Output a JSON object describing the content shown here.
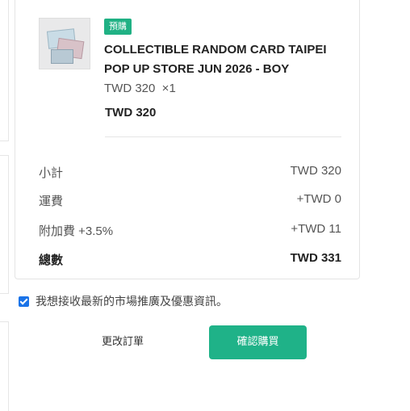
{
  "product": {
    "badge": "預購",
    "name": "COLLECTIBLE RANDOM CARD TAIPEI POP UP STORE JUN 2026 - BOY",
    "unit_price_qty": "TWD 320  ×1",
    "line_total": "TWD 320",
    "image_icon": "product-card-image"
  },
  "summary": {
    "subtotal_label": "小計",
    "subtotal_value": "TWD 320",
    "shipping_label": "運費",
    "shipping_value": "+TWD 0",
    "surcharge_label": "附加費 +3.5%",
    "surcharge_value": "+TWD 11",
    "total_label": "總數",
    "total_value": "TWD 331"
  },
  "consent": {
    "checked": true,
    "label": "我想接收最新的市場推廣及優惠資訊。"
  },
  "actions": {
    "edit_order": "更改訂單",
    "confirm_purchase": "確認購買"
  },
  "colors": {
    "accent": "#1fb288",
    "checkbox": "#1a73e8"
  }
}
